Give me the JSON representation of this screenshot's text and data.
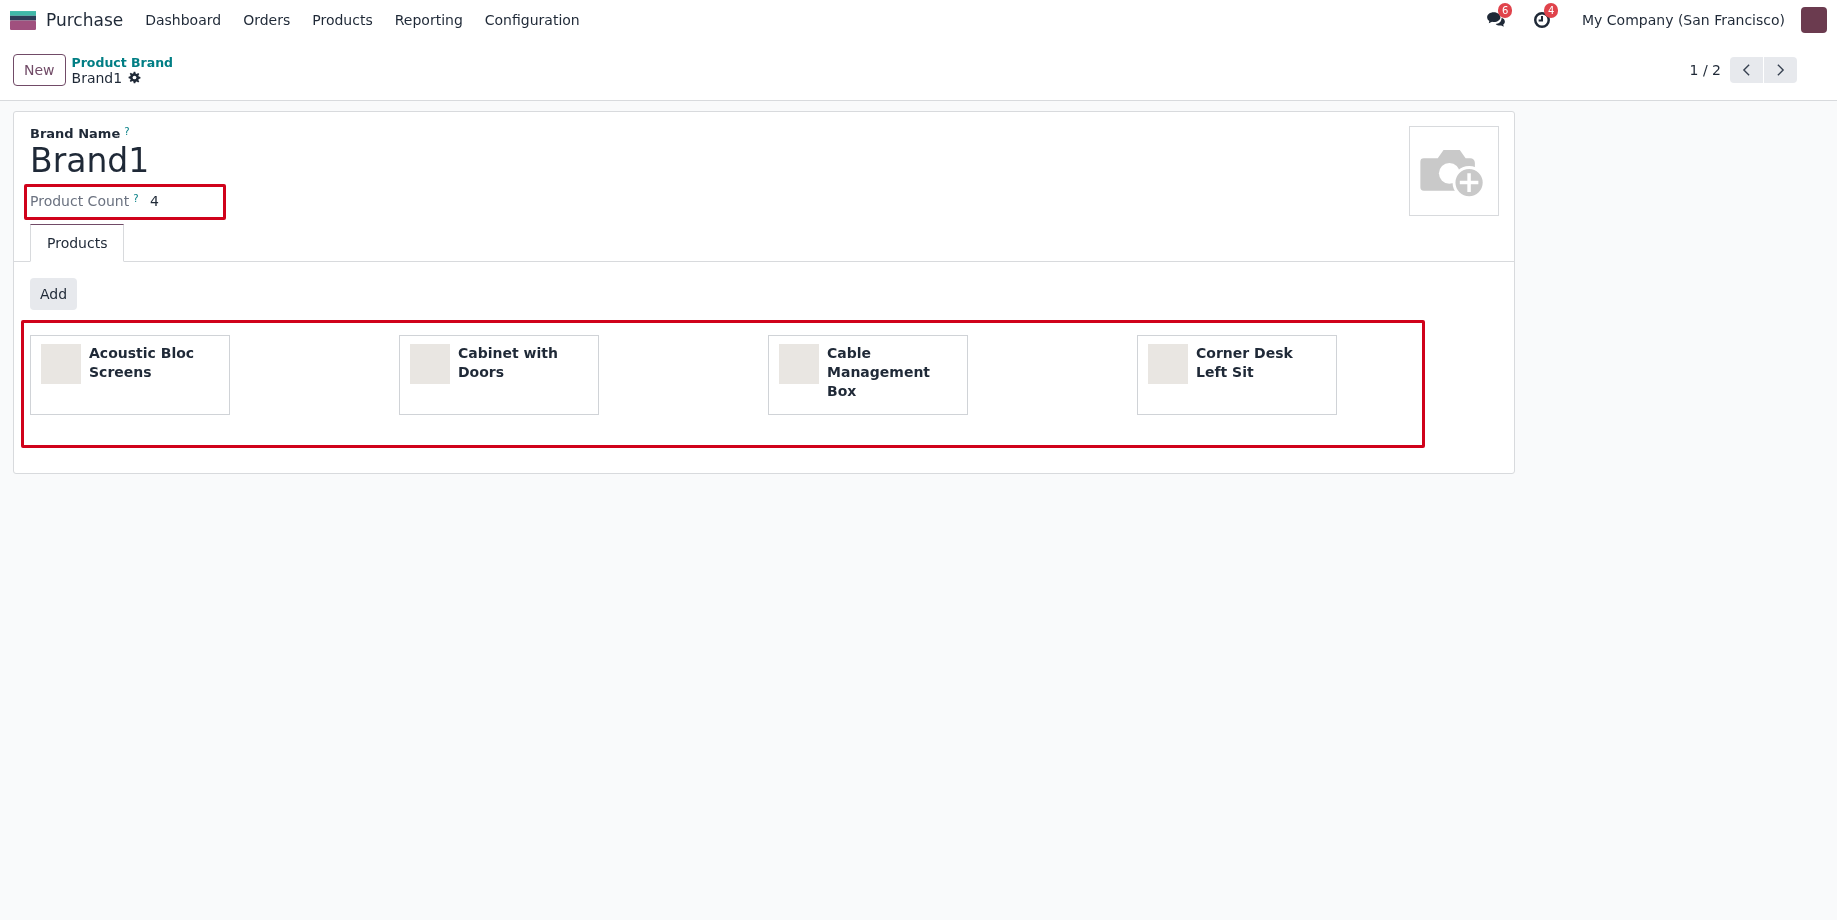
{
  "navbar": {
    "app": "Purchase",
    "menu": [
      "Dashboard",
      "Orders",
      "Products",
      "Reporting",
      "Configuration"
    ],
    "messages_badge": "6",
    "activities_badge": "4",
    "company": "My Company (San Francisco)"
  },
  "control_panel": {
    "new_button": "New",
    "breadcrumb": "Product Brand",
    "record": "Brand1",
    "pager": "1 / 2"
  },
  "form": {
    "brand_name_label": "Brand Name",
    "brand_name_help": "?",
    "brand_name": "Brand1",
    "product_count_label": "Product Count",
    "product_count_help": "?",
    "product_count": "4",
    "tabs": [
      {
        "label": "Products",
        "selected": true
      }
    ],
    "add_button": "Add",
    "products": [
      {
        "name": "Acoustic Bloc Screens"
      },
      {
        "name": "Cabinet with Doors"
      },
      {
        "name": "Cable Management Box"
      },
      {
        "name": "Corner Desk Left Sit"
      }
    ]
  }
}
